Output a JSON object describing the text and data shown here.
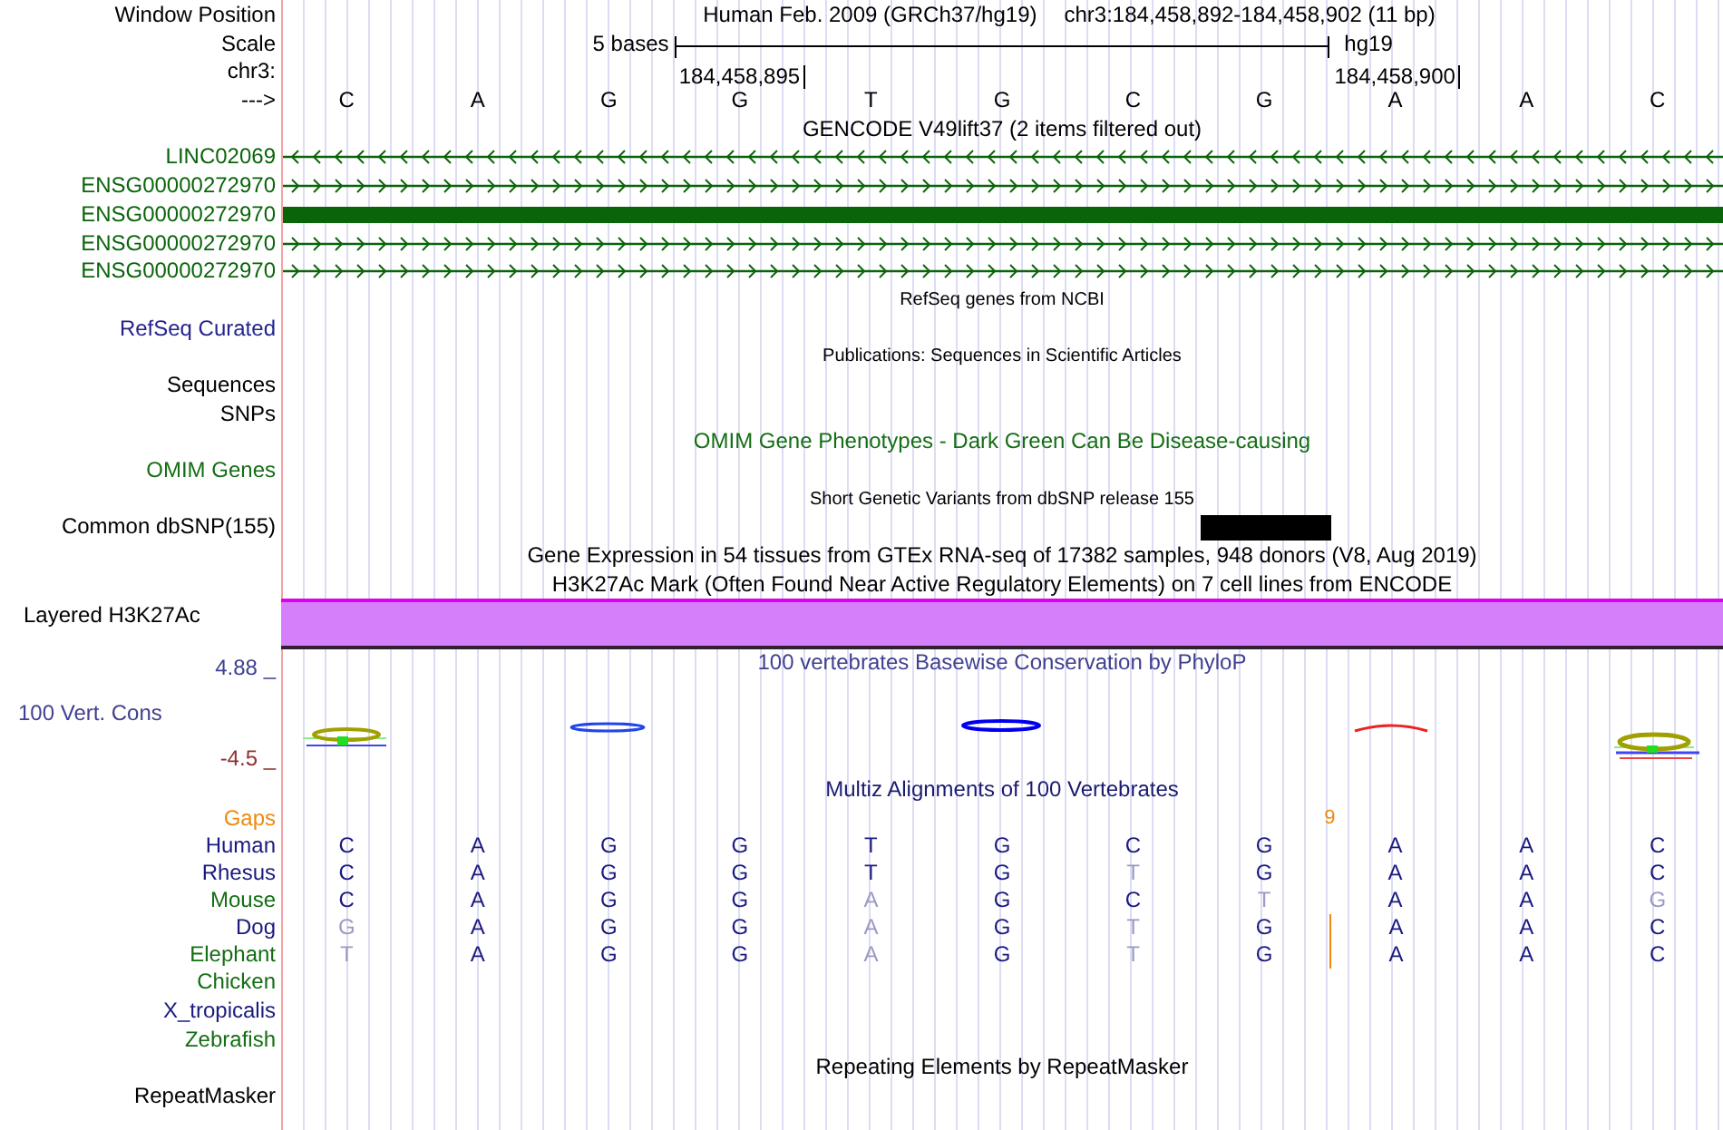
{
  "rows": [
    {
      "kind": "position",
      "label": "Window Position",
      "assembly": "Human Feb. 2009 (GRCh37/hg19)",
      "position": "chr3:184,458,892-184,458,902 (11 bp)"
    },
    {
      "kind": "scale",
      "label": "Scale",
      "text": "5 bases",
      "db": "hg19"
    },
    {
      "kind": "coords",
      "label": "chr3:",
      "ticks": [
        "184,458,895",
        "184,458,900"
      ]
    },
    {
      "kind": "bases",
      "label": "--->",
      "bases": [
        "C",
        "A",
        "G",
        "G",
        "T",
        "G",
        "C",
        "G",
        "A",
        "A",
        "C"
      ]
    },
    {
      "kind": "title",
      "title": "GENCODE V49lift37 (2 items filtered out)"
    },
    {
      "kind": "gene",
      "label": "LINC02069",
      "reverse": true,
      "color": "#0a640a"
    },
    {
      "kind": "gene",
      "label": "ENSG00000272970",
      "reverse": false,
      "color": "#0a640a"
    },
    {
      "kind": "gene-block",
      "label": "ENSG00000272970",
      "color": "#0a640a"
    },
    {
      "kind": "gene",
      "label": "ENSG00000272970",
      "reverse": false,
      "color": "#0a640a"
    },
    {
      "kind": "gene",
      "label": "ENSG00000272970",
      "reverse": false,
      "color": "#0a640a"
    },
    {
      "kind": "small-title",
      "title": "RefSeq genes from NCBI"
    },
    {
      "kind": "label",
      "label": "RefSeq Curated",
      "color": "#24248c"
    },
    {
      "kind": "small-title",
      "title": "Publications: Sequences in Scientific Articles"
    },
    {
      "kind": "label",
      "label": "Sequences"
    },
    {
      "kind": "label",
      "label": "SNPs"
    },
    {
      "kind": "title",
      "title": "OMIM Gene Phenotypes - Dark Green Can Be Disease-causing",
      "color": "#146e14"
    },
    {
      "kind": "label",
      "label": "OMIM Genes",
      "color": "#146e14"
    },
    {
      "kind": "small-title",
      "title": "Short Genetic Variants from dbSNP release 155"
    },
    {
      "kind": "snp",
      "label": "Common dbSNP(155)",
      "hits": [
        false,
        false,
        false,
        false,
        false,
        false,
        false,
        true,
        false,
        false,
        false
      ]
    },
    {
      "kind": "title",
      "title": "Gene Expression in 54 tissues from GTEx RNA-seq of 17382 samples, 948 donors (V8, Aug 2019)"
    },
    {
      "kind": "title",
      "title": "H3K27Ac Mark (Often Found Near Active Regulatory Elements) on 7 cell lines from ENCODE"
    },
    {
      "kind": "band",
      "label": "Layered H3K27Ac"
    },
    {
      "kind": "wiggle",
      "title": "100 vertebrates Basewise Conservation by PhyloP",
      "label": "100 Vert. Cons",
      "max": "4.88 _",
      "min": "-4.5 _"
    },
    {
      "kind": "title",
      "title": "Multiz Alignments of 100 Vertebrates",
      "color": "#1a1a70"
    },
    {
      "kind": "gaps",
      "label": "Gaps",
      "color": "#ee8a10",
      "count": "9",
      "gap_before": [
        false,
        false,
        false,
        false,
        false,
        false,
        false,
        false,
        true,
        false,
        false
      ]
    },
    {
      "kind": "species",
      "label": "Human",
      "color": "#1a1a80",
      "bases": [
        {
          "base": "C",
          "match": true,
          "gap_before": false
        },
        {
          "base": "A",
          "match": true,
          "gap_before": false
        },
        {
          "base": "G",
          "match": true,
          "gap_before": false
        },
        {
          "base": "G",
          "match": true,
          "gap_before": false
        },
        {
          "base": "T",
          "match": true,
          "gap_before": false
        },
        {
          "base": "G",
          "match": true,
          "gap_before": false
        },
        {
          "base": "C",
          "match": true,
          "gap_before": false
        },
        {
          "base": "G",
          "match": true,
          "gap_before": false
        },
        {
          "base": "A",
          "match": true,
          "gap_before": false
        },
        {
          "base": "A",
          "match": true,
          "gap_before": false
        },
        {
          "base": "C",
          "match": true,
          "gap_before": false
        }
      ]
    },
    {
      "kind": "species",
      "label": "Rhesus",
      "color": "#1a1a80",
      "bases": [
        {
          "base": "C",
          "match": true,
          "gap_before": false
        },
        {
          "base": "A",
          "match": true,
          "gap_before": false
        },
        {
          "base": "G",
          "match": true,
          "gap_before": false
        },
        {
          "base": "G",
          "match": true,
          "gap_before": false
        },
        {
          "base": "T",
          "match": true,
          "gap_before": false
        },
        {
          "base": "G",
          "match": true,
          "gap_before": false
        },
        {
          "base": "T",
          "match": false,
          "gap_before": false
        },
        {
          "base": "G",
          "match": true,
          "gap_before": false
        },
        {
          "base": "A",
          "match": true,
          "gap_before": false
        },
        {
          "base": "A",
          "match": true,
          "gap_before": false
        },
        {
          "base": "C",
          "match": true,
          "gap_before": false
        }
      ]
    },
    {
      "kind": "species",
      "label": "Mouse",
      "color": "#146e14",
      "bases": [
        {
          "base": "C",
          "match": true,
          "gap_before": false
        },
        {
          "base": "A",
          "match": true,
          "gap_before": false
        },
        {
          "base": "G",
          "match": true,
          "gap_before": false
        },
        {
          "base": "G",
          "match": true,
          "gap_before": false
        },
        {
          "base": "A",
          "match": false,
          "gap_before": false
        },
        {
          "base": "G",
          "match": true,
          "gap_before": false
        },
        {
          "base": "C",
          "match": true,
          "gap_before": false
        },
        {
          "base": "T",
          "match": false,
          "gap_before": false
        },
        {
          "base": "A",
          "match": true,
          "gap_before": false
        },
        {
          "base": "A",
          "match": true,
          "gap_before": false
        },
        {
          "base": "G",
          "match": false,
          "gap_before": false
        }
      ]
    },
    {
      "kind": "species",
      "label": "Dog",
      "color": "#1a1a80",
      "bases": [
        {
          "base": "G",
          "match": false,
          "gap_before": false
        },
        {
          "base": "A",
          "match": true,
          "gap_before": false
        },
        {
          "base": "G",
          "match": true,
          "gap_before": false
        },
        {
          "base": "G",
          "match": true,
          "gap_before": false
        },
        {
          "base": "A",
          "match": false,
          "gap_before": false
        },
        {
          "base": "G",
          "match": true,
          "gap_before": false
        },
        {
          "base": "T",
          "match": false,
          "gap_before": false
        },
        {
          "base": "G",
          "match": true,
          "gap_before": false
        },
        {
          "base": "A",
          "match": true,
          "gap_before": true
        },
        {
          "base": "A",
          "match": true,
          "gap_before": false
        },
        {
          "base": "C",
          "match": true,
          "gap_before": false
        }
      ]
    },
    {
      "kind": "species",
      "label": "Elephant",
      "color": "#146e14",
      "bases": [
        {
          "base": "T",
          "match": false,
          "gap_before": false
        },
        {
          "base": "A",
          "match": true,
          "gap_before": false
        },
        {
          "base": "G",
          "match": true,
          "gap_before": false
        },
        {
          "base": "G",
          "match": true,
          "gap_before": false
        },
        {
          "base": "A",
          "match": false,
          "gap_before": false
        },
        {
          "base": "G",
          "match": true,
          "gap_before": false
        },
        {
          "base": "T",
          "match": false,
          "gap_before": false
        },
        {
          "base": "G",
          "match": true,
          "gap_before": false
        },
        {
          "base": "A",
          "match": true,
          "gap_before": true
        },
        {
          "base": "A",
          "match": true,
          "gap_before": false
        },
        {
          "base": "C",
          "match": true,
          "gap_before": false
        }
      ]
    },
    {
      "kind": "label",
      "label": "Chicken",
      "color": "#146e14"
    },
    {
      "kind": "label",
      "label": "X_tropicalis",
      "color": "#1a1a80"
    },
    {
      "kind": "label",
      "label": "Zebrafish",
      "color": "#146e14"
    },
    {
      "kind": "title",
      "title": "Repeating Elements by RepeatMasker"
    },
    {
      "kind": "label",
      "label": "RepeatMasker"
    }
  ]
}
